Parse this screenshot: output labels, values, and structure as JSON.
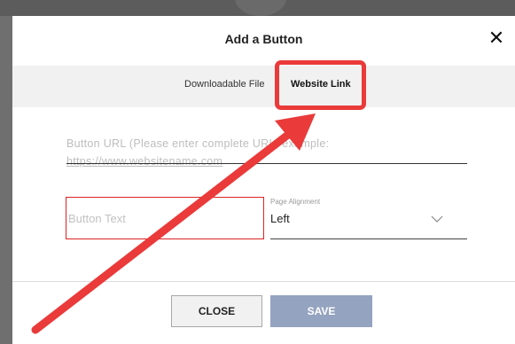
{
  "modal": {
    "title": "Add a Button",
    "close_icon_glyph": "✕"
  },
  "tabs": [
    {
      "label": "Downloadable File",
      "active": false
    },
    {
      "label": "Website Link",
      "active": true
    }
  ],
  "form": {
    "url_placeholder_line1": "Button URL (Please enter complete URL, example:",
    "url_placeholder_line2": "https://www.websitename.com",
    "button_text_placeholder": "Button Text",
    "alignment_label": "Page Alignment",
    "alignment_value": "Left"
  },
  "footer": {
    "close_label": "CLOSE",
    "save_label": "SAVE"
  },
  "annotation": {
    "highlight_color": "#ea3a3a",
    "arrow_color": "#ea3a3a"
  },
  "colors": {
    "save_button_bg": "#94a3bf",
    "tabbar_bg": "#f1f1f1",
    "backdrop": "#6f6f6f"
  }
}
